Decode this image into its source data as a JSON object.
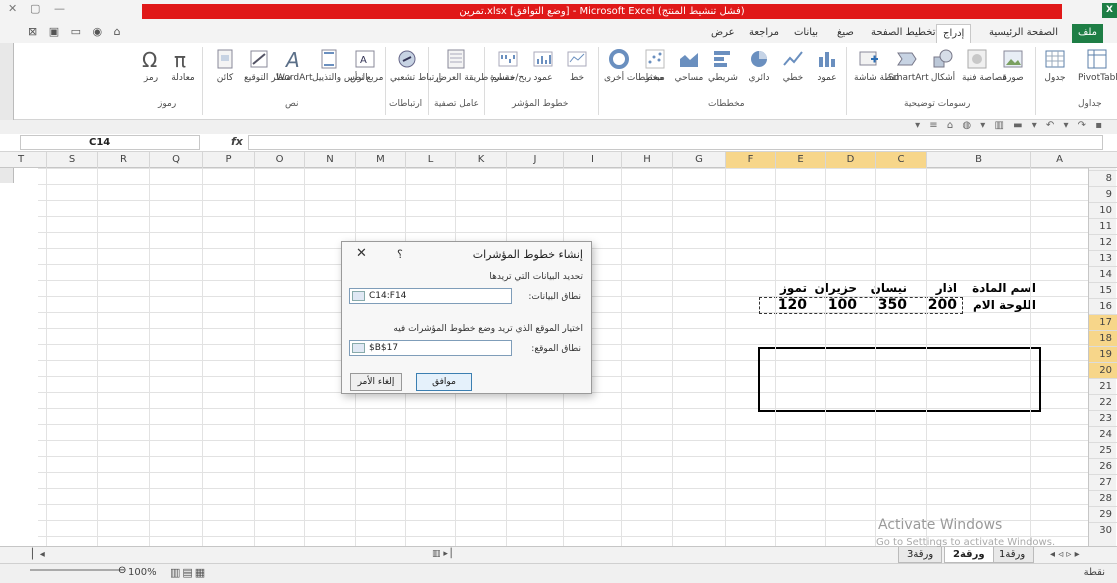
{
  "window": {
    "title": "تمرين.xlsx  [وضع التوافق] - Microsoft Excel (فشل تنشيط المنتج)",
    "app_icon_letter": "X",
    "controls": [
      "✕",
      "▢",
      "—"
    ]
  },
  "tabs": [
    {
      "label": "ملف",
      "active": false,
      "file": true
    },
    {
      "label": "الصفحة الرئيسية",
      "active": false
    },
    {
      "label": "إدراج",
      "active": true
    },
    {
      "label": "تخطيط الصفحة",
      "active": false
    },
    {
      "label": "صيغ",
      "active": false
    },
    {
      "label": "بيانات",
      "active": false
    },
    {
      "label": "مراجعة",
      "active": false
    },
    {
      "label": "عرض",
      "active": false
    }
  ],
  "ribbon": {
    "buttons": [
      {
        "label": "PivotTable",
        "icon": "pivot-table-icon"
      },
      {
        "label": "جدول",
        "icon": "table-icon"
      },
      {
        "label": "صورة",
        "icon": "picture-icon"
      },
      {
        "label": "قصاصة فنية",
        "icon": "clipart-icon"
      },
      {
        "label": "أشكال",
        "icon": "shapes-icon"
      },
      {
        "label": "SmartArt",
        "icon": "smartart-icon"
      },
      {
        "label": "لقطة شاشة",
        "icon": "screenshot-icon"
      },
      {
        "label": "عمود",
        "icon": "column-chart-icon"
      },
      {
        "label": "خطي",
        "icon": "line-chart-icon"
      },
      {
        "label": "دائري",
        "icon": "pie-chart-icon"
      },
      {
        "label": "شريطي",
        "icon": "bar-chart-icon"
      },
      {
        "label": "مساحي",
        "icon": "area-chart-icon"
      },
      {
        "label": "مبعثر",
        "icon": "scatter-chart-icon"
      },
      {
        "label": "مخططات أخرى",
        "icon": "other-charts-icon"
      },
      {
        "label": "خط",
        "icon": "sparkline-line-icon"
      },
      {
        "label": "عمود",
        "icon": "sparkline-column-icon"
      },
      {
        "label": "ربح/خسارة",
        "icon": "sparkline-winloss-icon"
      },
      {
        "label": "مقسم طريقة العرض",
        "icon": "slicer-icon"
      },
      {
        "label": "ارتباط تشعبي",
        "icon": "hyperlink-icon"
      },
      {
        "label": "مربع نص",
        "icon": "textbox-icon"
      },
      {
        "label": "الرأس والتذييل",
        "icon": "header-footer-icon"
      },
      {
        "label": "WordArt",
        "icon": "wordart-icon"
      },
      {
        "label": "سطر التوقيع",
        "icon": "signature-icon"
      },
      {
        "label": "كائن",
        "icon": "object-icon"
      },
      {
        "label": "معادلة",
        "icon": "equation-icon"
      },
      {
        "label": "رمز",
        "icon": "symbol-icon"
      }
    ],
    "groups": [
      "جداول",
      "رسومات توضيحية",
      "مخططات",
      "خطوط المؤشر",
      "عامل تصفية",
      "ارتباطات",
      "نص",
      "رموز"
    ]
  },
  "formula_bar": {
    "name_box": "C14",
    "fx": "fx",
    "content": ""
  },
  "columns": [
    "A",
    "B",
    "C",
    "D",
    "E",
    "F",
    "G",
    "H",
    "I",
    "J",
    "K",
    "L",
    "M",
    "N",
    "O",
    "P",
    "Q",
    "R",
    "S",
    "T"
  ],
  "rows": [
    "8",
    "9",
    "10",
    "11",
    "12",
    "13",
    "14",
    "15",
    "16",
    "17",
    "18",
    "19",
    "20",
    "21",
    "22",
    "23",
    "24",
    "25",
    "26",
    "27",
    "28",
    "29",
    "30"
  ],
  "cells": {
    "B13": "اسم المادة",
    "C13": "اذار",
    "D13": "نيسان",
    "E13": "حزيران",
    "F13": "تموز",
    "B14": "اللوحة الام",
    "C14": "200",
    "D14": "350",
    "E14": "100",
    "F14": "120"
  },
  "dialog": {
    "title": "إنشاء خطوط المؤشرات",
    "help": "؟",
    "close": "✕",
    "section1": "تحديد البيانات التي تريدها",
    "data_range_label": "نطاق البيانات:",
    "data_range_value": "C14:F14",
    "section2": "اختيار الموقع الذي تريد وضع خطوط المؤشرات فيه",
    "location_label": "نطاق الموقع:",
    "location_value": "$B$17",
    "ok": "موافق",
    "cancel": "إلغاء الأمر"
  },
  "sheets": [
    {
      "label": "ورقة1",
      "active": false
    },
    {
      "label": "ورقة2",
      "active": true
    },
    {
      "label": "ورقة3",
      "active": false
    }
  ],
  "status": {
    "ready": "نقطة",
    "zoom": "100%"
  },
  "watermark": {
    "line1": "Activate Windows",
    "line2": "Go to Settings to activate Windows."
  }
}
